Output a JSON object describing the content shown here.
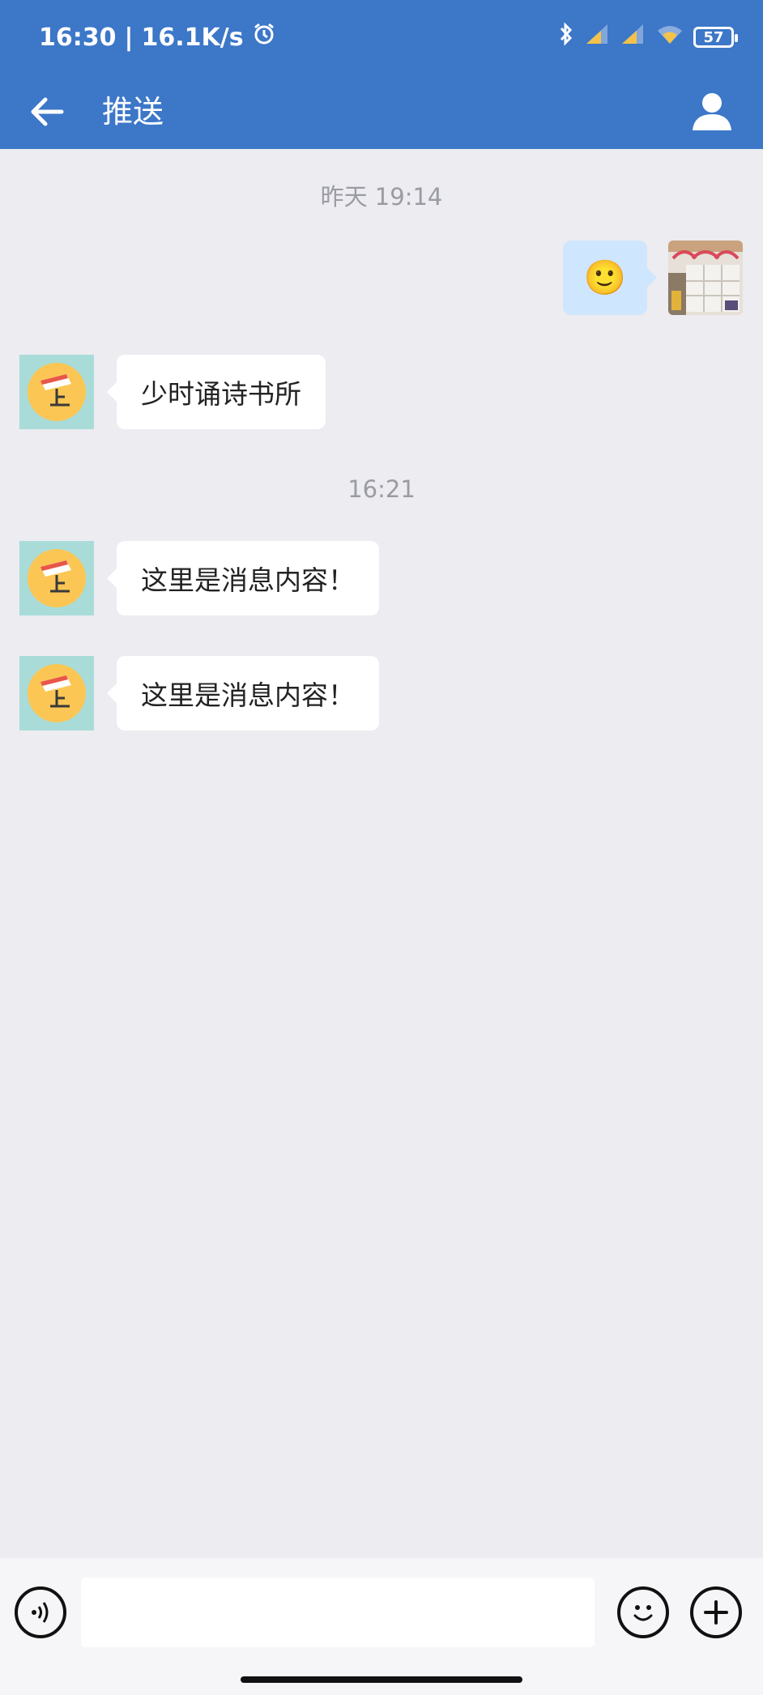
{
  "status_bar": {
    "time": "16:30",
    "separator": "|",
    "network_speed": "16.1K/s",
    "battery_level": "57"
  },
  "header": {
    "title": "推送"
  },
  "chat": {
    "timestamps": [
      "昨天  19:14",
      "16:21"
    ],
    "messages": [
      {
        "from": "me",
        "content_type": "emoji",
        "emoji": "🙂"
      },
      {
        "from": "other",
        "text": "少时诵诗书所"
      },
      {
        "from": "other",
        "text": "这里是消息内容！"
      },
      {
        "from": "other",
        "text": "这里是消息内容！"
      }
    ]
  },
  "input_bar": {
    "input_value": "",
    "input_placeholder": ""
  },
  "colors": {
    "header": "#3c77c8",
    "background": "#ececf1",
    "outgoing_bubble": "#cfe6ff",
    "incoming_bubble": "#ffffff",
    "avatar_bg": "#a9dcd8",
    "avatar_disc": "#fbc654",
    "timestamp_text": "#9a9ca3"
  },
  "icons": {
    "alarm": "alarm-icon",
    "bluetooth": "bluetooth-icon",
    "signal": "signal-icon",
    "wifi": "wifi-icon",
    "battery": "battery-icon",
    "back": "arrow-left-icon",
    "profile": "person-icon",
    "voice": "voice-icon",
    "emoji": "smiley-icon",
    "add": "plus-icon"
  }
}
